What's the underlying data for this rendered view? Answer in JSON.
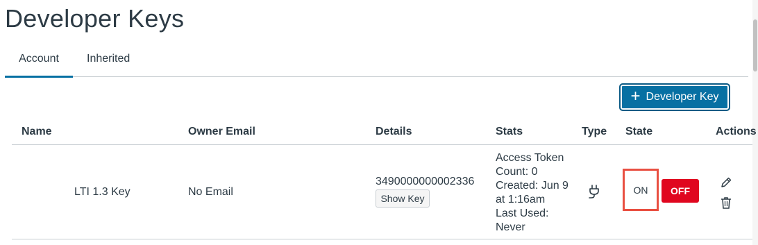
{
  "page": {
    "title": "Developer Keys"
  },
  "tabs": [
    {
      "label": "Account",
      "active": true
    },
    {
      "label": "Inherited",
      "active": false
    }
  ],
  "toolbar": {
    "add_button_label": "Developer Key",
    "add_button_icon": "plus-icon"
  },
  "table": {
    "headers": [
      "Name",
      "Owner Email",
      "Details",
      "Stats",
      "Type",
      "State",
      "Actions"
    ],
    "rows": [
      {
        "name": "LTI 1.3 Key",
        "owner_email": "No Email",
        "details_key": "3490000000002336",
        "show_key_label": "Show Key",
        "stats": [
          "Access Token",
          "Count: 0",
          "Created: Jun 9",
          "at 1:16am",
          "Last Used:",
          "Never"
        ],
        "type_icon": "plug-icon",
        "state_on_label": "ON",
        "state_off_label": "OFF",
        "state_selected": "OFF",
        "actions": [
          "edit-icon",
          "trash-icon"
        ]
      }
    ]
  },
  "colors": {
    "primary": "#0770a3",
    "danger": "#e0061f",
    "highlight": "#e94f41",
    "text": "#2d3b45"
  }
}
